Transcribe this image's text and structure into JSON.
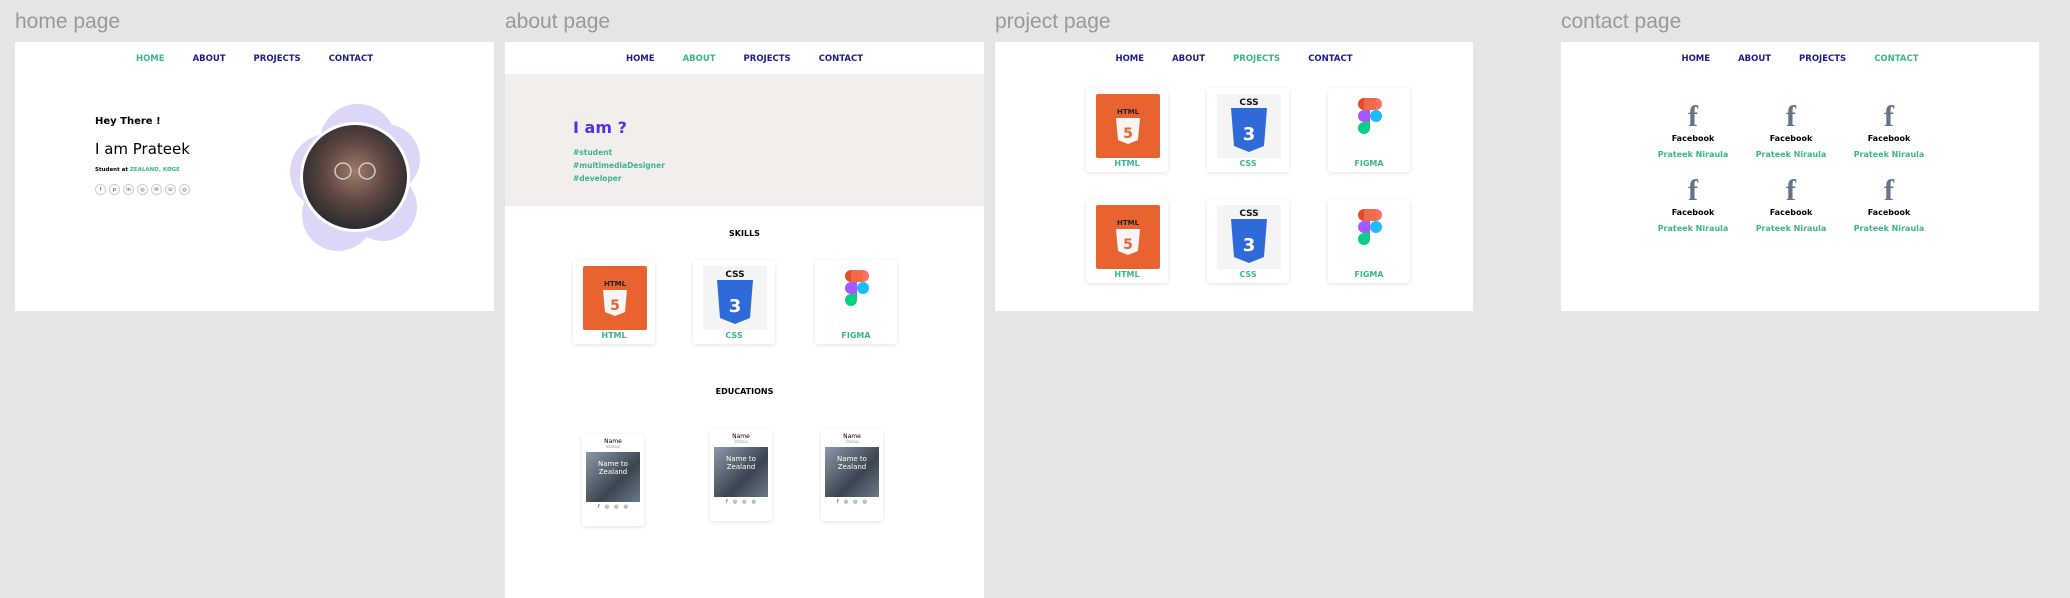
{
  "frames": {
    "home": "home page",
    "about": "about page",
    "project": "project page",
    "contact": "contact page"
  },
  "nav": {
    "home": "HOME",
    "about": "ABOUT",
    "projects": "PROJECTS",
    "contact": "CONTACT"
  },
  "home": {
    "greeting": "Hey There !",
    "name": "I am Prateek",
    "role_prefix": "Student at",
    "role_place": "ZEALAND, KØGE"
  },
  "about": {
    "heading": "I am ?",
    "tags": [
      "#student",
      "#multimediaDesigner",
      "#developer"
    ],
    "skills_title": "SKILLS",
    "educations_title": "EDUCATIONS",
    "edu_card": {
      "name": "Name",
      "status": "status",
      "photo_text": "Name to Zealand"
    }
  },
  "skills": {
    "html": "HTML",
    "css": "CSS",
    "figma": "FIGMA"
  },
  "contact": {
    "platform": "Facebook",
    "person": "Prateek Niraula"
  },
  "colors": {
    "accent": "#3cb58a",
    "nav": "#1c1c8c",
    "purple": "#5b2de0",
    "html_orange": "#e8632f",
    "css_blue": "#2f6bd8"
  }
}
